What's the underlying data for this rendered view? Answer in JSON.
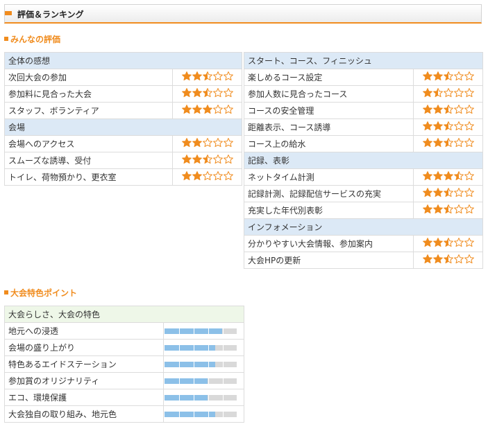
{
  "header": {
    "title": "評価＆ランキング"
  },
  "ratings_section": {
    "title": "みんなの評価"
  },
  "left_table": [
    {
      "type": "category",
      "label": "全体の感想"
    },
    {
      "type": "item",
      "label": "次回大会の参加",
      "rating": 2.5
    },
    {
      "type": "item",
      "label": "参加料に見合った大会",
      "rating": 2.5
    },
    {
      "type": "item",
      "label": "スタッフ、ボランティア",
      "rating": 3
    },
    {
      "type": "category",
      "label": "会場"
    },
    {
      "type": "item",
      "label": "会場へのアクセス",
      "rating": 2
    },
    {
      "type": "item",
      "label": "スムーズな誘導、受付",
      "rating": 2.5
    },
    {
      "type": "item",
      "label": "トイレ、荷物預かり、更衣室",
      "rating": 2
    }
  ],
  "right_table": [
    {
      "type": "category",
      "label": "スタート、コース、フィニッシュ"
    },
    {
      "type": "item",
      "label": "楽しめるコース設定",
      "rating": 2.5
    },
    {
      "type": "item",
      "label": "参加人数に見合ったコース",
      "rating": 1.5
    },
    {
      "type": "item",
      "label": "コースの安全管理",
      "rating": 2.5
    },
    {
      "type": "item",
      "label": "距離表示、コース誘導",
      "rating": 2.5
    },
    {
      "type": "item",
      "label": "コース上の給水",
      "rating": 2.5
    },
    {
      "type": "category",
      "label": "記録、表彰"
    },
    {
      "type": "item",
      "label": "ネットタイム計測",
      "rating": 3.5
    },
    {
      "type": "item",
      "label": "記録計測、記録配信サービスの充実",
      "rating": 2.5
    },
    {
      "type": "item",
      "label": "充実した年代別表彰",
      "rating": 2.5
    },
    {
      "type": "category",
      "label": "インフォメーション"
    },
    {
      "type": "item",
      "label": "分かりやすい大会情報、参加案内",
      "rating": 2.5
    },
    {
      "type": "item",
      "label": "大会HPの更新",
      "rating": 2.5
    }
  ],
  "features_section": {
    "title": "大会特色ポイント"
  },
  "features_table": {
    "category": "大会らしさ、大会の特色",
    "items": [
      {
        "label": "地元への浸透",
        "level": 0.8
      },
      {
        "label": "会場の盛り上がり",
        "level": 0.7
      },
      {
        "label": "特色あるエイドステーション",
        "level": 0.7
      },
      {
        "label": "参加賞のオリジナリティ",
        "level": 0.6
      },
      {
        "label": "エコ、環境保護",
        "level": 0.6
      },
      {
        "label": "大会独自の取り組み、地元色",
        "level": 0.7
      }
    ]
  },
  "colors": {
    "accent": "#f08c1e",
    "star_fill": "#f08c1e",
    "category_bg": "#dce9f6",
    "feature_category_bg": "#eef7e8",
    "bar_fill": "#8cc0e8",
    "bar_empty": "#d9d9d9"
  },
  "icons": {
    "star_full": "star-full-icon",
    "star_half": "star-half-icon",
    "star_empty": "star-empty-icon"
  }
}
